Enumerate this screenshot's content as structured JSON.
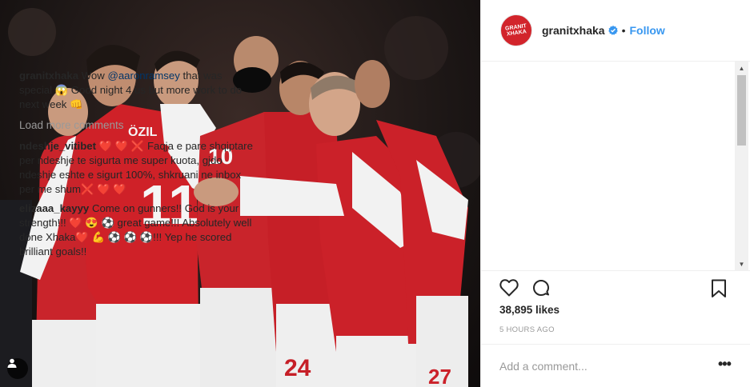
{
  "post": {
    "username": "granitxhaka",
    "follow_label": "Follow",
    "avatar_text": "GRANIT XHAKA",
    "dot": "•"
  },
  "caption": {
    "user": "granitxhaka",
    "pre": "Wow ",
    "mention": "@aaronramsey",
    "post": " that was special 😱 Good night 4 us but more work to do next week 👊"
  },
  "load_more": "Load more comments",
  "comments": [
    {
      "user": "ndeshje_vitibet",
      "text": "❤️ ❤️ ❌ Faqja e pare shqiptare per ndeshje te sigurta me super kuota, gjdo ndeshje eshte e sigurt 100%, shkruani ne inbox per me shum❌ ❤️ ❤️"
    },
    {
      "user": "elizaaa_kayyy",
      "text": "Come on gunners!! God is your strength!!! ❤️ 😍 ⚽ great game!!! Absolutely well done Xhaka❤️ 💪 ⚽ ⚽ ⚽!!! Yep he scored brilliant goals!!"
    }
  ],
  "likes": "38,895 likes",
  "time_ago": "5 HOURS AGO",
  "add_comment_placeholder": "Add a comment...",
  "more_options": "•••",
  "colors": {
    "accent": "#3897f0",
    "arsenal_red": "#d2242b",
    "text": "#262626",
    "muted": "#999999"
  },
  "icons": {
    "like": "heart-outline-icon",
    "comment": "speech-bubble-icon",
    "save": "bookmark-icon",
    "verified": "verified-badge-icon",
    "tag": "user-tag-icon"
  }
}
